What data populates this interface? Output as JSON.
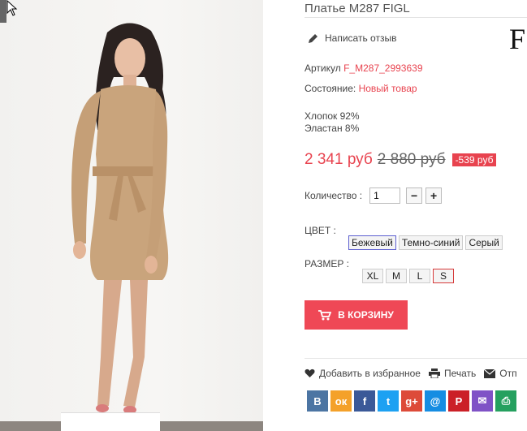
{
  "product": {
    "title": "Платье M287 FIGL",
    "brand_logo": "F",
    "review_link": "Написать отзыв",
    "article_label": "Артикул",
    "article_value": "F_M287_2993639",
    "condition_label": "Состояние:",
    "condition_value": "Новый товар",
    "composition": [
      "Хлопок 92%",
      "Эластан 8%"
    ]
  },
  "price": {
    "current": "2 341 руб",
    "old": "2 880 руб",
    "discount": "-539 руб"
  },
  "quantity": {
    "label": "Количество :",
    "value": "1",
    "minus": "−",
    "plus": "+"
  },
  "color": {
    "label": "ЦВЕТ :",
    "options": [
      "Бежевый",
      "Темно-синий",
      "Серый"
    ],
    "selected": "Бежевый"
  },
  "size": {
    "label": "РАЗМЕР :",
    "options": [
      "XL",
      "M",
      "L",
      "S"
    ],
    "selected": "S"
  },
  "cart": {
    "label": "В КОРЗИНУ",
    "icon": "cart-icon"
  },
  "actions": {
    "favorite": "Добавить в избранное",
    "print": "Печать",
    "send": "Отп"
  },
  "socials": [
    {
      "name": "vk",
      "glyph": "В",
      "color": "#4c75a3"
    },
    {
      "name": "odnoklassniki",
      "glyph": "ок",
      "color": "#f4a12a"
    },
    {
      "name": "facebook",
      "glyph": "f",
      "color": "#3b5998"
    },
    {
      "name": "twitter",
      "glyph": "t",
      "color": "#1da1f2"
    },
    {
      "name": "google-plus",
      "glyph": "g+",
      "color": "#dd4b39"
    },
    {
      "name": "mail",
      "glyph": "@",
      "color": "#168de2"
    },
    {
      "name": "pinterest",
      "glyph": "P",
      "color": "#cb2027"
    },
    {
      "name": "email",
      "glyph": "✉",
      "color": "#7f52c6"
    },
    {
      "name": "print",
      "glyph": "⎙",
      "color": "#25a05f"
    }
  ],
  "colors": {
    "accent": "#e8434f",
    "cart_button": "#ef4856"
  }
}
